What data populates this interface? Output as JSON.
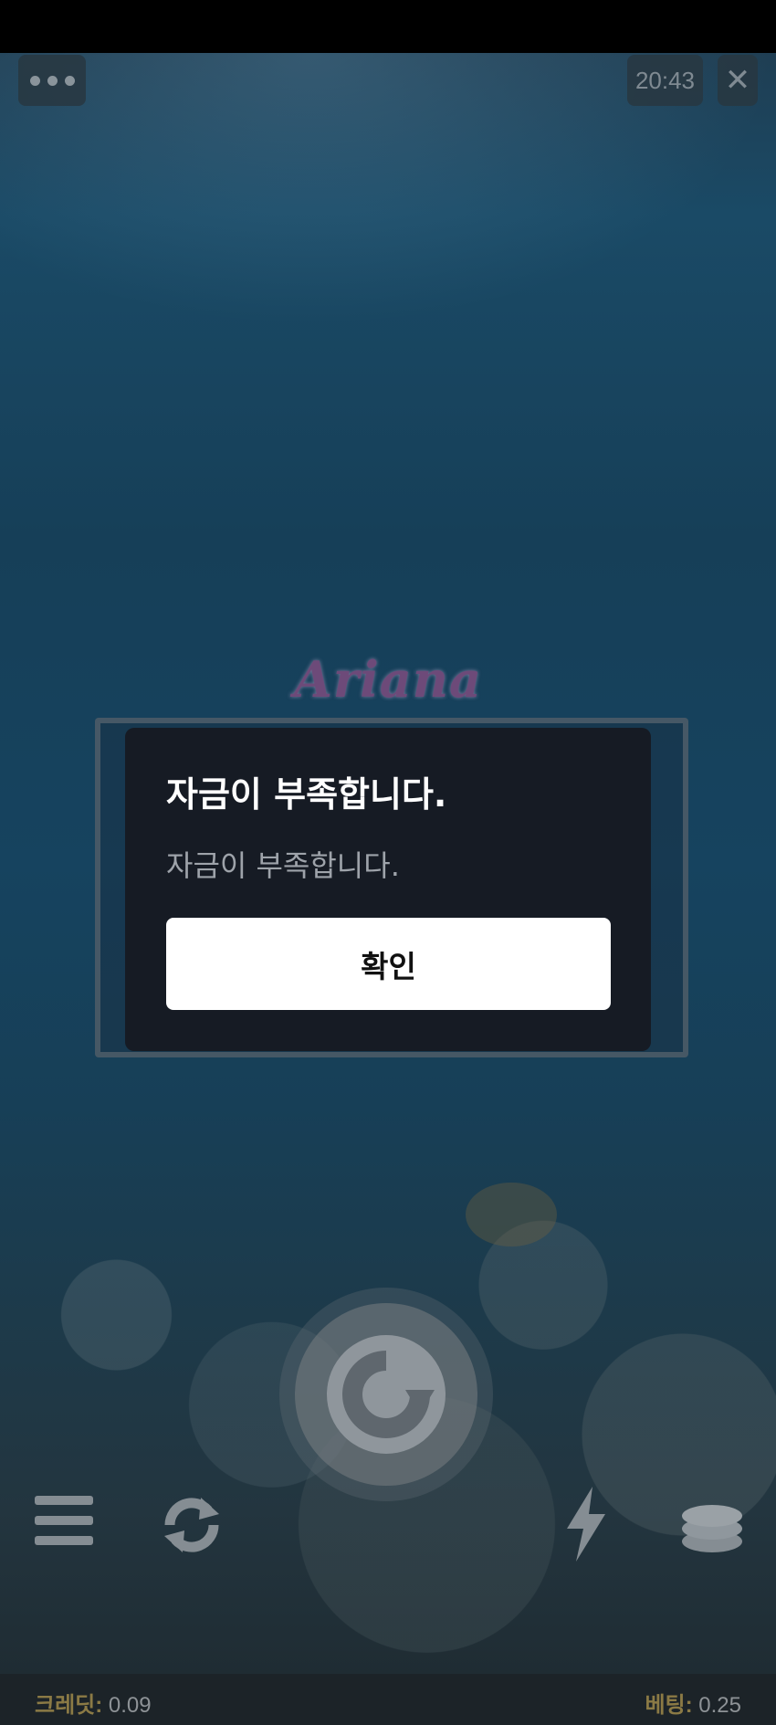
{
  "top_bar": {
    "clock": "20:43",
    "close_symbol": "✕",
    "menu_icon": "more-dots-icon"
  },
  "game": {
    "logo": "Ariana"
  },
  "dialog": {
    "title": "자금이 부족합니다.",
    "message": "자금이 부족합니다.",
    "confirm_label": "확인"
  },
  "controls": {
    "spin_icon": "spin-icon",
    "menu_icon": "hamburger-icon",
    "autoplay_icon": "autoplay-icon",
    "turbo_icon": "lightning-icon",
    "bet_icon": "coin-stack-icon"
  },
  "footer": {
    "credit_label": "크레딧:",
    "credit_value": "0.09",
    "bet_label": "베팅:",
    "bet_value": "0.25"
  },
  "colors": {
    "modal_bg": "#161b24",
    "confirm_bg": "#ffffff",
    "label_gold": "#8b7a45"
  }
}
